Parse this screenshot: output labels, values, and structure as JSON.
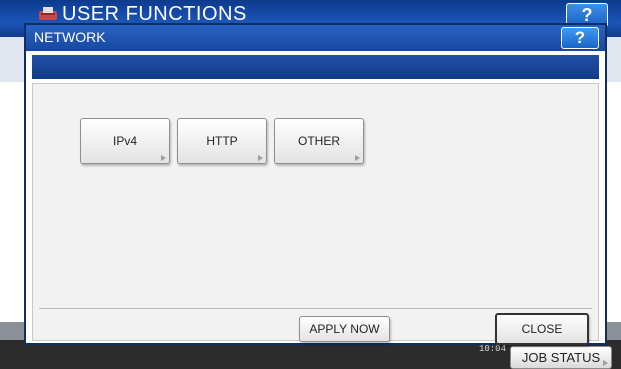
{
  "app": {
    "title": "USER FUNCTIONS",
    "help_label": "?",
    "datetime_top": "",
    "datetime_time": "10:04",
    "job_status_label": "JOB STATUS"
  },
  "dialog": {
    "title": "NETWORK",
    "help_label": "?",
    "buttons": [
      {
        "label": "IPv4"
      },
      {
        "label": "HTTP"
      },
      {
        "label": "OTHER"
      }
    ],
    "apply_label": "APPLY NOW",
    "close_label": "CLOSE"
  },
  "colors": {
    "header_blue": "#1747a0",
    "help_blue": "#1864c8"
  }
}
